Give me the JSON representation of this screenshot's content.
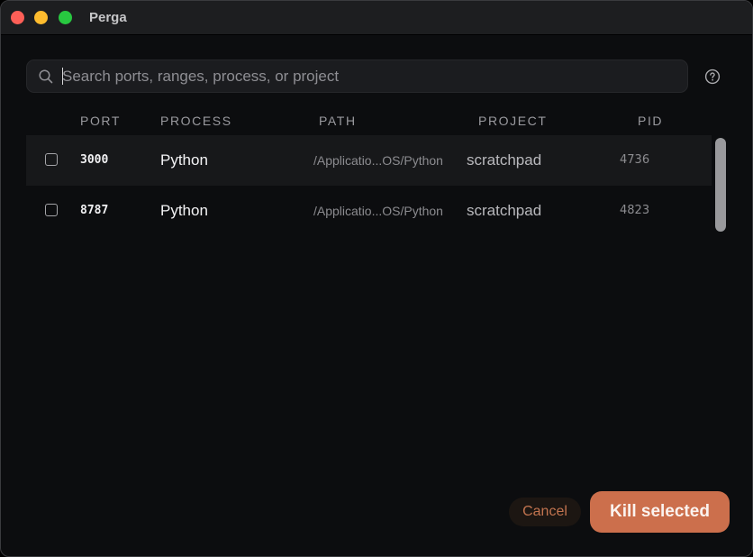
{
  "window": {
    "title": "Perga"
  },
  "search": {
    "value": "",
    "placeholder": "Search ports, ranges, process, or project",
    "icon": "search-icon"
  },
  "help": {
    "icon": "question-circle-icon"
  },
  "table": {
    "columns": [
      "PORT",
      "PROCESS",
      "PATH",
      "PROJECT",
      "PID"
    ],
    "rows": [
      {
        "checked": false,
        "port": "3000",
        "process": "Python",
        "path": "/Applicatio...OS/Python",
        "project": "scratchpad",
        "pid": "4736"
      },
      {
        "checked": false,
        "port": "8787",
        "process": "Python",
        "path": "/Applicatio...OS/Python",
        "project": "scratchpad",
        "pid": "4823"
      }
    ]
  },
  "actions": {
    "cancel_label": "Cancel",
    "kill_label": "Kill selected"
  },
  "colors": {
    "accent": "#cc6f4c",
    "background": "#0c0d0f",
    "titlebar": "#1d1e20"
  }
}
